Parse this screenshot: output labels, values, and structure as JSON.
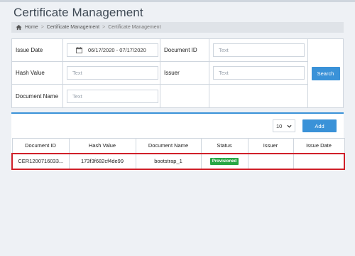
{
  "page": {
    "title": "Certificate Management"
  },
  "breadcrumb": {
    "home": "Home",
    "sep": ">",
    "section": "Certificate Management",
    "current": "Certificate Management"
  },
  "search": {
    "issue_date_label": "Issue Date",
    "issue_date_value": "06/17/2020 - 07/17/2020",
    "document_id_label": "Document ID",
    "document_id_placeholder": "Text",
    "hash_value_label": "Hash Value",
    "hash_value_placeholder": "Text",
    "issuer_label": "Issuer",
    "issuer_placeholder": "Text",
    "document_name_label": "Document Name",
    "document_name_placeholder": "Text",
    "search_button": "Search"
  },
  "results": {
    "page_size": "10",
    "add_button": "Add",
    "columns": [
      "Document ID",
      "Hash Value",
      "Document Name",
      "Status",
      "Issuer",
      "Issue Date"
    ],
    "rows": [
      {
        "document_id": "CER1200716033...",
        "hash_value": "173f3f682cf4de99",
        "document_name": "bootstrap_1",
        "status": "Provisioned",
        "issuer": "",
        "issue_date": ""
      }
    ]
  },
  "colors": {
    "accent": "#3a92d8",
    "status_provisioned": "#27a744",
    "selection_outline": "#d0202a"
  }
}
